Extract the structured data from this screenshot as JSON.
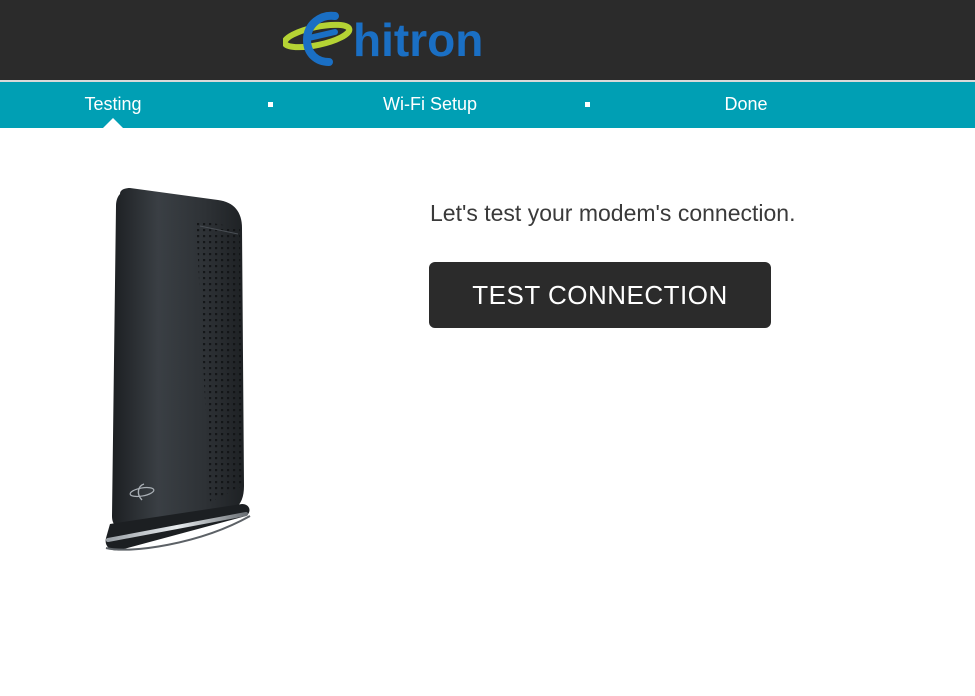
{
  "brand": {
    "name": "hitron",
    "logo_text_color": "#1a6fc4",
    "logo_swoosh_color": "#b5d334"
  },
  "colors": {
    "header_bg": "#2b2b2b",
    "stepbar_bg": "#009fb4",
    "button_bg": "#2b2b2b"
  },
  "steps": [
    {
      "label": "Testing",
      "active": true
    },
    {
      "label": "Wi-Fi Setup",
      "active": false
    },
    {
      "label": "Done",
      "active": false
    }
  ],
  "main": {
    "prompt": "Let's test your modem's connection.",
    "button_label": "TEST CONNECTION",
    "image": "modem-device-image"
  }
}
